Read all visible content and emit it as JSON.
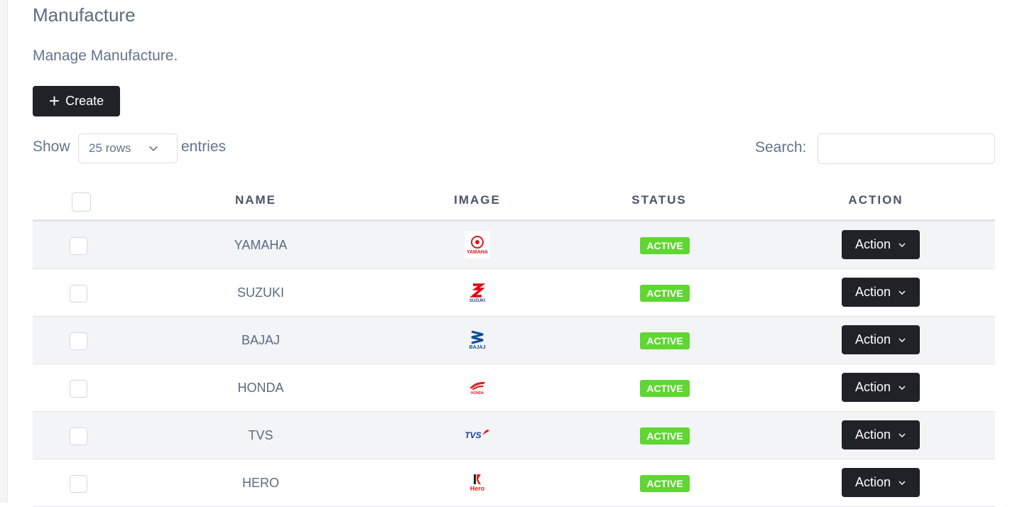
{
  "page": {
    "title": "Manufacture",
    "subtitle": "Manage Manufacture."
  },
  "toolbar": {
    "create_label": "Create",
    "show_label": "Show",
    "rows_value": "25 rows",
    "entries_label": "entries",
    "search_label": "Search:",
    "search_value": ""
  },
  "table": {
    "columns": [
      "NAME",
      "IMAGE",
      "STATUS",
      "ACTION"
    ],
    "rows": [
      {
        "name": "YAMAHA",
        "logo_text": "YAMAHA",
        "logo_color": "#d71920",
        "status": "ACTIVE",
        "action": "Action"
      },
      {
        "name": "SUZUKI",
        "logo_text": "SUZUKI",
        "logo_color": "#e30613",
        "status": "ACTIVE",
        "action": "Action"
      },
      {
        "name": "BAJAJ",
        "logo_text": "BAJAJ",
        "logo_color": "#0a4da2",
        "status": "ACTIVE",
        "action": "Action"
      },
      {
        "name": "HONDA",
        "logo_text": "HONDA",
        "logo_color": "#e31b23",
        "status": "ACTIVE",
        "action": "Action"
      },
      {
        "name": "TVS",
        "logo_text": "TVS",
        "logo_color": "#1c3f94",
        "status": "ACTIVE",
        "action": "Action"
      },
      {
        "name": "HERO",
        "logo_text": "Hero",
        "logo_color": "#e1251b",
        "status": "ACTIVE",
        "action": "Action"
      }
    ]
  },
  "colors": {
    "primary_button": "#1f2227",
    "status_active": "#5fd632",
    "text": "#64748b"
  },
  "icons": {
    "create": "plus-icon",
    "select": "chevron-down-icon",
    "action": "chevron-down-icon"
  }
}
